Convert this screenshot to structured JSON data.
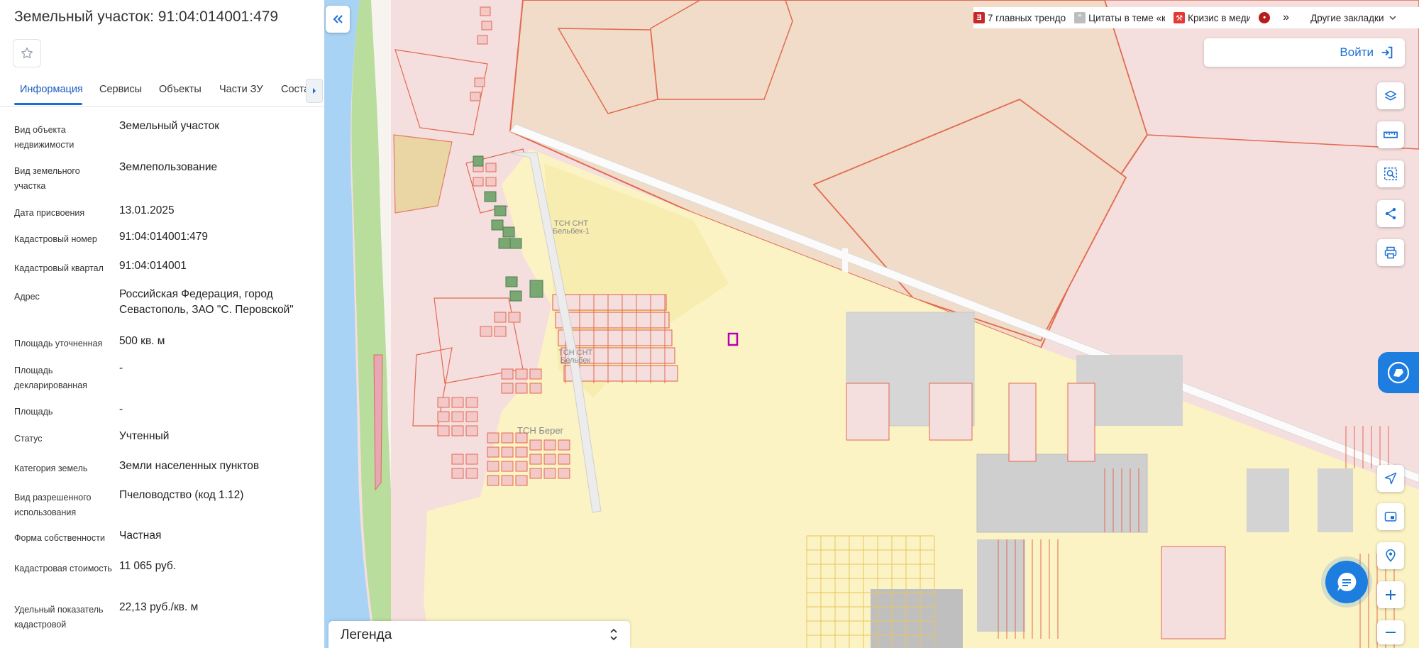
{
  "panel": {
    "title": "Земельный участок: 91:04:014001:479",
    "tabs": [
      "Информация",
      "Сервисы",
      "Объекты",
      "Части ЗУ",
      "Соста"
    ],
    "properties": [
      {
        "label": "Вид объекта недвижимости",
        "value": "Земельный участок"
      },
      {
        "label": "Вид земельного участка",
        "value": "Землепользование"
      },
      {
        "label": "Дата присвоения",
        "value": "13.01.2025"
      },
      {
        "label": "Кадастровый номер",
        "value": "91:04:014001:479"
      },
      {
        "label": "Кадастровый квартал",
        "value": "91:04:014001"
      },
      {
        "label": "Адрес",
        "value": "Российская Федерация, город Севастополь, ЗАО \"С. Перовской\""
      },
      {
        "label": "Площадь уточненная",
        "value": "500 кв. м"
      },
      {
        "label": "Площадь декларированная",
        "value": "-"
      },
      {
        "label": "Площадь",
        "value": "-"
      },
      {
        "label": "Статус",
        "value": "Учтенный"
      },
      {
        "label": "Категория земель",
        "value": "Земли населенных пунктов"
      },
      {
        "label": "Вид разрешенного использования",
        "value": "Пчеловодство (код 1.12)"
      },
      {
        "label": "Форма собственности",
        "value": "Частная"
      },
      {
        "label": "Кадастровая стоимость",
        "value": "11 065 руб."
      },
      {
        "label": "Удельный показатель кадастровой",
        "value": "22,13 руб./кв. м"
      }
    ]
  },
  "bookmarks": {
    "items": [
      "7 главных трендо",
      "Цитаты в теме «к",
      "Кризис в меди"
    ],
    "more": "»",
    "other": "Другие закладки"
  },
  "map": {
    "login_label": "Войти",
    "legend_label": "Легенда",
    "labels": {
      "tsn_belbek1_a": "ТСН СНТ",
      "tsn_belbek1_b": "Бельбек-1",
      "tsn_belbek_a": "ТСН СНТ",
      "tsn_belbek_b": "Бельбек",
      "tsn_bereg": "ТСН Берег"
    }
  },
  "colors": {
    "accent": "#1a6fd6",
    "parcel_pink": "#f5dede",
    "parcel_yellow": "#fbf3c4",
    "water": "#a9d3f5",
    "border_red": "#e26a50"
  }
}
